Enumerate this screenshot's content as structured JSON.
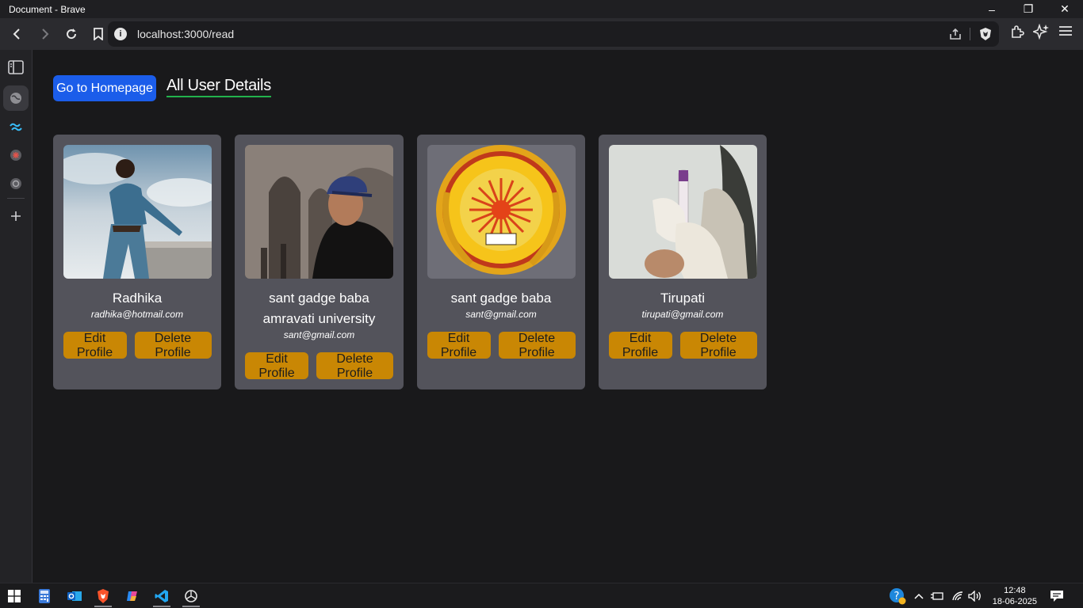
{
  "window": {
    "title": "Document - Brave"
  },
  "browser": {
    "url": "localhost:3000/read"
  },
  "page": {
    "home_button": "Go to Homepage",
    "heading": "All User Details"
  },
  "users": [
    {
      "name": "Radhika",
      "email": "radhika@hotmail.com",
      "photo": "woman-posing-photo"
    },
    {
      "name": "sant gadge baba amravati university",
      "email": "sant@gmail.com",
      "photo": "man-in-cap-photo"
    },
    {
      "name": "sant gadge baba",
      "email": "sant@gmail.com",
      "photo": "university-logo"
    },
    {
      "name": "Tirupati",
      "email": "tirupati@gmail.com",
      "photo": "gloved-hands-vial-photo"
    }
  ],
  "card_buttons": {
    "edit": "Edit Profile",
    "delete": "Delete Profile"
  },
  "taskbar": {
    "time": "12:48",
    "date": "18-06-2025"
  },
  "colors": {
    "primary": "#1b5dea",
    "accent_underline": "#22b24c",
    "action": "#c98704",
    "card": "#53535b"
  }
}
